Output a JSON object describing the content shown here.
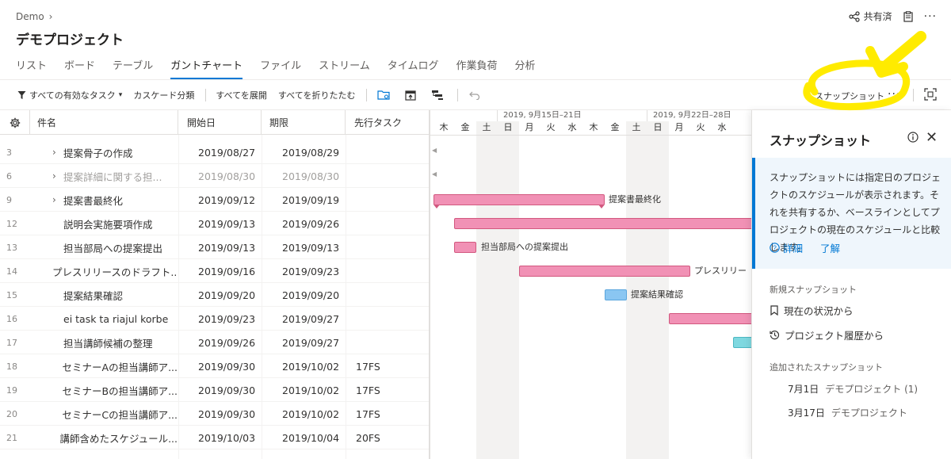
{
  "breadcrumb": {
    "root": "Demo",
    "chevron": "›"
  },
  "project": {
    "title": "デモプロジェクト"
  },
  "header": {
    "share_label": "共有済",
    "more": "···",
    "share_icon": "share-icon",
    "clipboard_icon": "clipboard-icon"
  },
  "tabs": [
    {
      "label": "リスト"
    },
    {
      "label": "ボード"
    },
    {
      "label": "テーブル"
    },
    {
      "label": "ガントチャート",
      "active": true
    },
    {
      "label": "ファイル"
    },
    {
      "label": "ストリーム"
    },
    {
      "label": "タイムログ"
    },
    {
      "label": "作業負荷"
    },
    {
      "label": "分析"
    }
  ],
  "toolbar": {
    "filter_label": "すべての有効なタスク",
    "filter_caret": "▾",
    "cascade_label": "カスケード分類",
    "expand_label": "すべてを展開",
    "collapse_label": "すべてを折りたたむ",
    "snapshot_label": "スナップショット",
    "more": "···"
  },
  "grid": {
    "headers": {
      "name": "件名",
      "start": "開始日",
      "end": "期限",
      "pred": "先行タスク"
    },
    "rows": [
      {
        "num": "3",
        "name": "提案骨子の作成",
        "start": "2019/08/27",
        "end": "2019/08/29",
        "pred": "",
        "expandable": true,
        "dim": false
      },
      {
        "num": "6",
        "name": "提案詳細に関する担...",
        "start": "2019/08/30",
        "end": "2019/08/30",
        "pred": "",
        "expandable": true,
        "dim": true
      },
      {
        "num": "9",
        "name": "提案書最終化",
        "start": "2019/09/12",
        "end": "2019/09/19",
        "pred": "",
        "expandable": true,
        "dim": false
      },
      {
        "num": "12",
        "name": "説明会実施要項作成",
        "start": "2019/09/13",
        "end": "2019/09/26",
        "pred": "",
        "expandable": false,
        "dim": false
      },
      {
        "num": "13",
        "name": "担当部局への提案提出",
        "start": "2019/09/13",
        "end": "2019/09/13",
        "pred": "",
        "expandable": false,
        "dim": false
      },
      {
        "num": "14",
        "name": "プレスリリースのドラフト...",
        "start": "2019/09/16",
        "end": "2019/09/23",
        "pred": "",
        "expandable": false,
        "dim": false
      },
      {
        "num": "15",
        "name": "提案結果確認",
        "start": "2019/09/20",
        "end": "2019/09/20",
        "pred": "",
        "expandable": false,
        "dim": false
      },
      {
        "num": "16",
        "name": "ei task ta riajul korbe",
        "start": "2019/09/23",
        "end": "2019/09/27",
        "pred": "",
        "expandable": false,
        "dim": false
      },
      {
        "num": "17",
        "name": "担当講師候補の整理",
        "start": "2019/09/26",
        "end": "2019/09/27",
        "pred": "",
        "expandable": false,
        "dim": false
      },
      {
        "num": "18",
        "name": "セミナーAの担当講師ア...",
        "start": "2019/09/30",
        "end": "2019/10/02",
        "pred": "17FS",
        "expandable": false,
        "dim": false
      },
      {
        "num": "19",
        "name": "セミナーBの担当講師ア...",
        "start": "2019/09/30",
        "end": "2019/10/02",
        "pred": "17FS",
        "expandable": false,
        "dim": false
      },
      {
        "num": "20",
        "name": "セミナーCの担当講師ア...",
        "start": "2019/09/30",
        "end": "2019/10/02",
        "pred": "17FS",
        "expandable": false,
        "dim": false
      },
      {
        "num": "21",
        "name": "講師含めたスケジュール...",
        "start": "2019/10/03",
        "end": "2019/10/04",
        "pred": "20FS",
        "expandable": false,
        "dim": false
      }
    ]
  },
  "gantt": {
    "weeks": [
      "2019, 9月15日–21日",
      "2019, 9月22日–28日"
    ],
    "days": [
      "木",
      "金",
      "土",
      "日",
      "月",
      "火",
      "水",
      "木",
      "金",
      "土",
      "日",
      "月",
      "火",
      "水"
    ],
    "bar_labels": {
      "row9": "提案書最終化",
      "row13": "担当部局への提案提出",
      "row14": "プレスリリー",
      "row15": "提案結果確認"
    },
    "colors": {
      "task": "#f191b5",
      "milestone": "#8ac6f2",
      "other": "#7fd8e0"
    }
  },
  "snapshot_panel": {
    "title": "スナップショット",
    "description": "スナップショットには指定日のプロジェクトのスケジュールが表示されます。それを共有するか、ベースラインとしてプロジェクトの現在のスケジュールと比較します。",
    "details_link": "詳細",
    "ok_link": "了解",
    "new_section": "新規スナップショット",
    "from_current": "現在の状況から",
    "from_history": "プロジェクト履歴から",
    "added_section": "追加されたスナップショット",
    "snapshots": [
      {
        "date": "7月1日",
        "name": "デモプロジェクト (1)"
      },
      {
        "date": "3月17日",
        "name": "デモプロジェクト"
      }
    ]
  },
  "accent_color": "#0078d4"
}
